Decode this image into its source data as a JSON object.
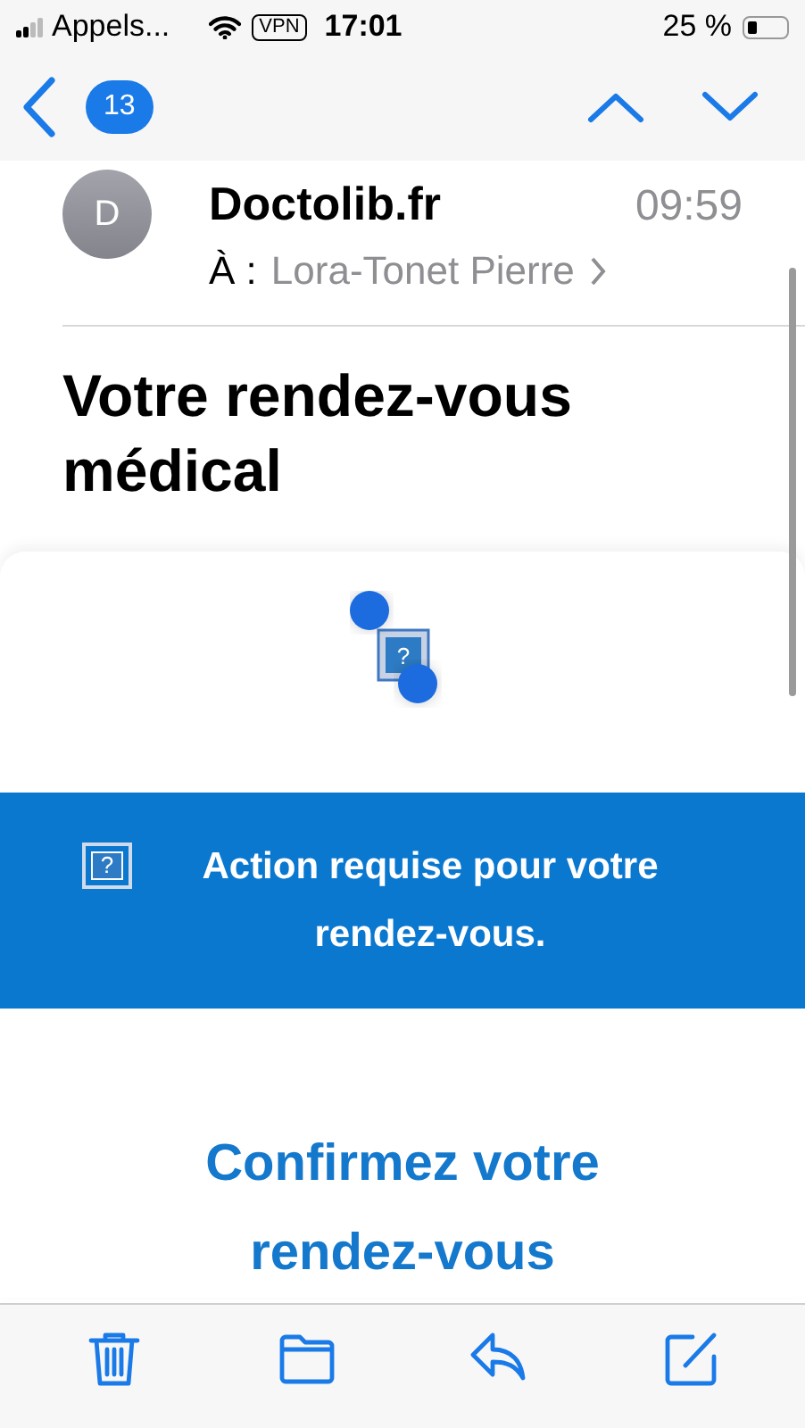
{
  "status_bar": {
    "carrier": "Appels...",
    "vpn": "VPN",
    "time": "17:01",
    "battery": "25 %"
  },
  "nav": {
    "unread_count": "13"
  },
  "message": {
    "avatar_initial": "D",
    "sender": "Doctolib.fr",
    "time": "09:59",
    "recipient_label": "À :",
    "recipient": "Lora-Tonet Pierre",
    "subject": "Votre rendez-vous médical"
  },
  "body": {
    "logo_glyph": "?",
    "banner_glyph": "?",
    "banner_text": "Action requise pour votre rendez-vous.",
    "heading": "Confirmez votre rendez-vous"
  },
  "toolbar": [
    {
      "kind": "trash"
    },
    {
      "kind": "folder"
    },
    {
      "kind": "reply"
    },
    {
      "kind": "compose"
    }
  ]
}
